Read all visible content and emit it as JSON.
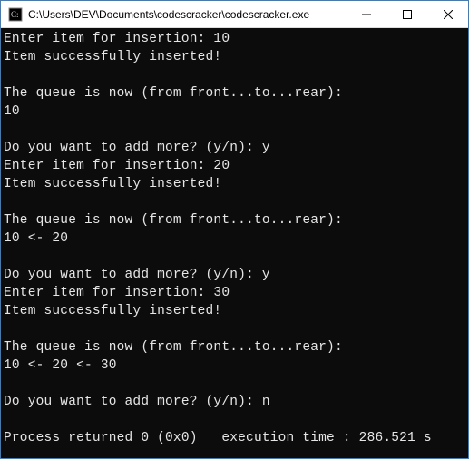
{
  "titlebar": {
    "path": "C:\\Users\\DEV\\Documents\\codescracker\\codescracker.exe"
  },
  "console": {
    "lines": "Enter item for insertion: 10\nItem successfully inserted!\n\nThe queue is now (from front...to...rear):\n10\n\nDo you want to add more? (y/n): y\nEnter item for insertion: 20\nItem successfully inserted!\n\nThe queue is now (from front...to...rear):\n10 <- 20\n\nDo you want to add more? (y/n): y\nEnter item for insertion: 30\nItem successfully inserted!\n\nThe queue is now (from front...to...rear):\n10 <- 20 <- 30\n\nDo you want to add more? (y/n): n\n\nProcess returned 0 (0x0)   execution time : 286.521 s"
  }
}
